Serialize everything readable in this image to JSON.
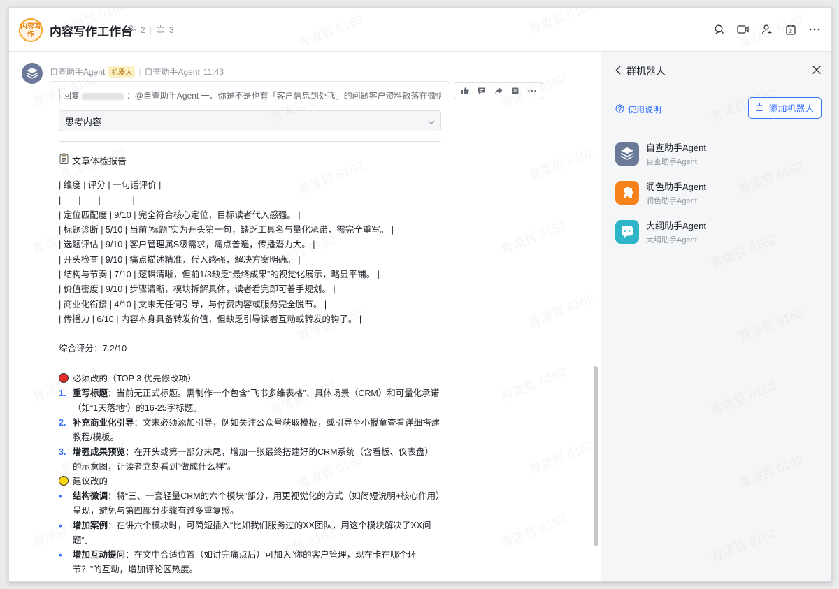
{
  "header": {
    "avatar_text": "内容写作",
    "title": "内容写作工作台",
    "member_count": "2",
    "bot_count": "3"
  },
  "message": {
    "sender_name": "自查助手Agent",
    "badge": "机器人",
    "sender_sub": "自查助手Agent",
    "time": "11:43",
    "reply_prefix": "回复",
    "reply_text": "：@自查助手Agent 一、你是不是也有「客户信息到处飞」的问题客户资料散落在微信聊...",
    "thinking_label": "思考内容",
    "report_title": "文章体检报告",
    "table_lines": [
      "| 维度 | 评分 | 一句话评价 |",
      "|------|------|-----------|",
      "| 定位匹配度 | 9/10 | 完全符合核心定位，目标读者代入感强。 |",
      "| 标题诊断 | 5/10 | 当前“标题”实为开头第一句，缺乏工具名与量化承诺，需完全重写。 |",
      "| 选题评估 | 9/10 | 客户管理属S级需求，痛点普遍，传播潜力大。 |",
      "| 开头检查 | 9/10 | 痛点描述精准，代入感强，解决方案明确。 |",
      "| 结构与节奏 | 7/10 | 逻辑清晰，但前1/3缺乏“最终成果”的视觉化展示，略显平铺。 |",
      "| 价值密度 | 9/10 | 步骤清晰，模块拆解具体，读者看完即可着手规划。 |",
      "| 商业化衔接 | 4/10 | 文末无任何引导，与付费内容或服务完全脱节。 |",
      "| 传播力 | 6/10 | 内容本身具备转发价值，但缺乏引导读者互动或转发的钩子。 |"
    ],
    "overall": "综合评分：7.2/10",
    "must_title": "必须改的（TOP 3 优先修改项）",
    "must_items": [
      {
        "num": "1.",
        "bold": "重写标题",
        "text": "：当前无正式标题。需制作一个包含“飞书多维表格”、具体场景（CRM）和可量化承诺（如“1天落地”）的16-25字标题。"
      },
      {
        "num": "2.",
        "bold": "补充商业化引导",
        "text": "：文末必须添加引导，例如关注公众号获取模板，或引导至小报童查看详细搭建教程/模板。"
      },
      {
        "num": "3.",
        "bold": "增强成果预览",
        "text": "：在开头或第一部分末尾，增加一张最终搭建好的CRM系统（含看板、仪表盘）的示意图，让读者立刻看到“做成什么样”。"
      }
    ],
    "suggest_title": "建议改的",
    "suggest_items": [
      {
        "bold": "结构微调",
        "text": "：将“三、一套轻量CRM的六个模块”部分，用更视觉化的方式（如简短说明+核心作用）呈现，避免与第四部分步骤有过多重复感。"
      },
      {
        "bold": "增加案例",
        "text": "：在讲六个模块时，可简短插入“比如我们服务过的XX团队，用这个模块解决了XX问题”。"
      },
      {
        "bold": "增加互动提问",
        "text": "：在文中合适位置（如讲完痛点后）可加入“你的客户管理，现在卡在哪个环节？”的互动，增加评论区热度。"
      }
    ]
  },
  "panel": {
    "title": "群机器人",
    "help": "使用说明",
    "add_button": "添加机器人",
    "bots": [
      {
        "name": "自查助手Agent",
        "sub": "自查助手Agent",
        "color": "#6b7a99"
      },
      {
        "name": "润色助手Agent",
        "sub": "润色助手Agent",
        "color": "#f7821b"
      },
      {
        "name": "大纲助手Agent",
        "sub": "大纲助手Agent",
        "color": "#2fb5c8"
      }
    ]
  },
  "watermark": "青泼哲 6162"
}
